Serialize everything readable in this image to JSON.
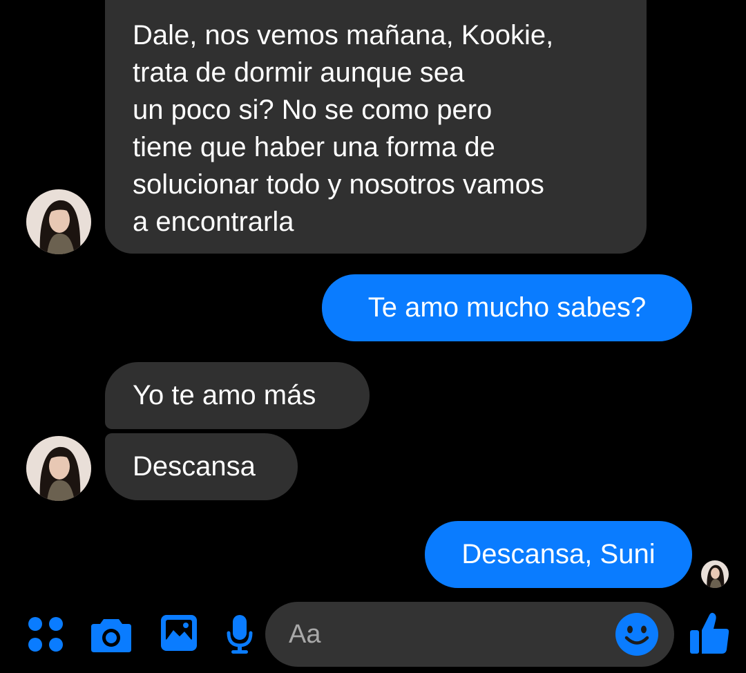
{
  "conversation": {
    "messages": [
      {
        "sender": "contact",
        "text": "Dale, nos vemos mañana, Kookie,\ntrata de dormir aunque sea\nun poco si? No se como pero\ntiene que haber una forma de\nsolucionar todo y nosotros vamos\na encontrarla"
      },
      {
        "sender": "me",
        "text": "Te amo mucho sabes?"
      },
      {
        "sender": "contact",
        "text": "Yo te amo más"
      },
      {
        "sender": "contact",
        "text": "Descansa"
      },
      {
        "sender": "me",
        "text": "Descansa, Suni"
      }
    ]
  },
  "composer": {
    "placeholder": "Aa",
    "value": ""
  },
  "icons": {
    "apps": "apps-grid-icon",
    "camera": "camera-icon",
    "gallery": "gallery-icon",
    "mic": "microphone-icon",
    "emoji": "emoji-icon",
    "like": "thumbs-up-icon"
  },
  "colors": {
    "background": "#000000",
    "incoming_bubble": "#303030",
    "outgoing_bubble": "#0a7cff",
    "accent": "#0a7cff",
    "composer_bg": "#333333"
  }
}
